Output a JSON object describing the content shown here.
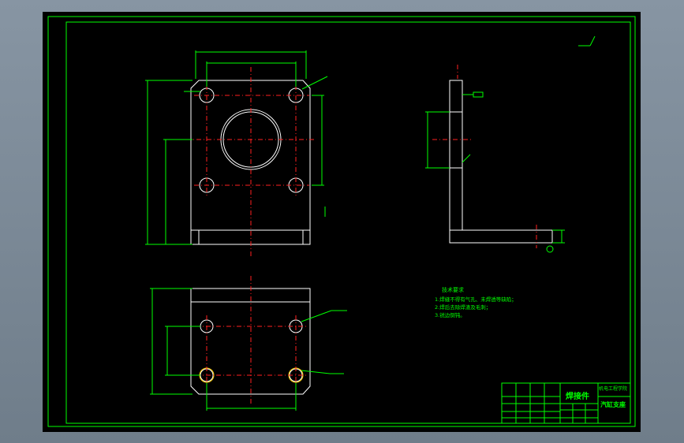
{
  "notes": {
    "heading": "技术要求",
    "items": [
      "1.焊缝不得有气孔、未焊透等缺陷；",
      "2.焊后去除焊渣及毛刺；",
      "3.锐边倒钝。"
    ]
  },
  "title_block": {
    "part_name": "焊接件",
    "drawing_name": "汽缸支座",
    "school": "机电工程学院"
  },
  "views": {
    "main": "front-view",
    "side": "side-section",
    "bottom": "top-view"
  }
}
